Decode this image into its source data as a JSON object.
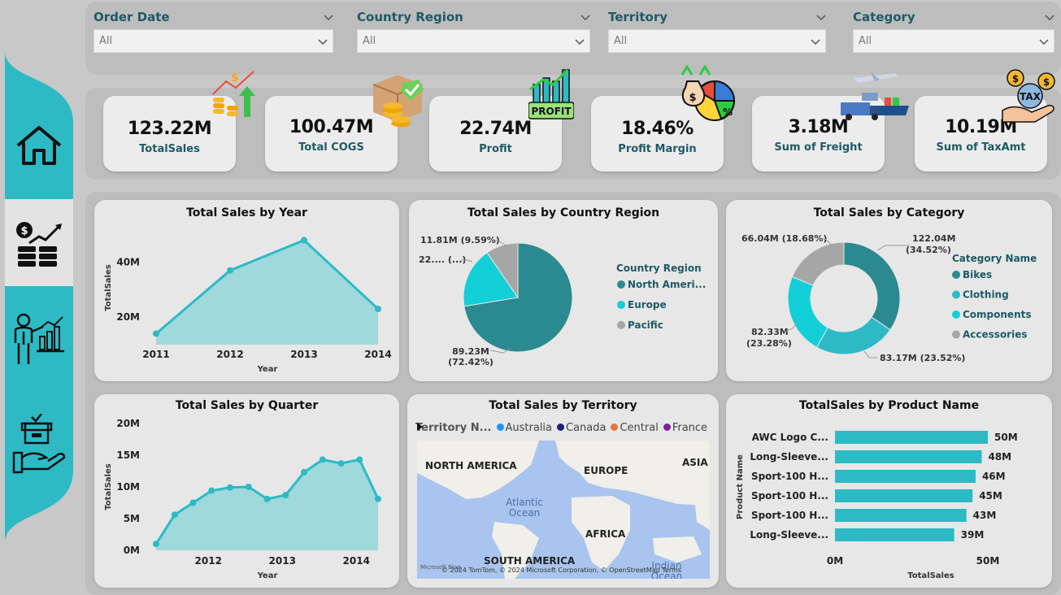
{
  "slicers": [
    {
      "title": "Order Date",
      "value": "All"
    },
    {
      "title": "Country Region",
      "value": "All"
    },
    {
      "title": "Territory",
      "value": "All"
    },
    {
      "title": "Category",
      "value": "All"
    }
  ],
  "kpis": [
    {
      "value": "123.22M",
      "label": "TotalSales",
      "icon": "coins-growth-icon"
    },
    {
      "value": "100.47M",
      "label": "Total COGS",
      "icon": "box-coins-icon"
    },
    {
      "value": "22.74M",
      "label": "Profit",
      "icon": "profit-chart-icon",
      "icon_text": "PROFIT"
    },
    {
      "value": "18.46%",
      "label": "Profit Margin",
      "icon": "money-pie-icon",
      "icon_text": "%"
    },
    {
      "value": "3.18M",
      "label": "Sum of Freight",
      "icon": "freight-icon"
    },
    {
      "value": "10.19M",
      "label": "Sum of TaxAmt",
      "icon": "tax-hand-icon",
      "icon_text": "TAX"
    }
  ],
  "colors": {
    "teal": "#2dbac5",
    "dark_teal": "#2b8a8f",
    "cyan": "#12cfd8",
    "gray": "#a6a6a6",
    "area": "#9fd9db"
  },
  "cards": {
    "sales_by_year": {
      "title": "Total Sales by Year",
      "xlabel": "Year",
      "ylabel": "TotalSales"
    },
    "sales_by_country": {
      "title": "Total Sales by Country Region",
      "legend_title": "Country Region"
    },
    "sales_by_category": {
      "title": "Total Sales by Category",
      "legend_title": "Category Name"
    },
    "sales_by_quarter": {
      "title": "Total Sales by Quarter",
      "xlabel": "Year",
      "ylabel": "TotalSales"
    },
    "sales_by_territory": {
      "title": "Total Sales by Territory",
      "legend_title": "Territory N...",
      "legend": [
        {
          "name": "Australia",
          "color": "#1e90ff"
        },
        {
          "name": "Canada",
          "color": "#1a237e"
        },
        {
          "name": "Central",
          "color": "#e8743b"
        },
        {
          "name": "France",
          "color": "#7b1fa2"
        }
      ],
      "labels": {
        "na": "NORTH AMERICA",
        "eu": "EUROPE",
        "as": "ASIA",
        "af": "AFRICA",
        "sa": "SOUTH AMERICA",
        "atlantic": "Atlantic Ocean",
        "indian": "Indian Ocean"
      },
      "attribution": "© 2024 TomTom, © 2024 Microsoft Corporation, © OpenStreetMap  Terms",
      "ms_logo": "Microsoft Bing"
    },
    "sales_by_product": {
      "title": "TotalSales by Product Name",
      "xlabel": "TotalSales",
      "ylabel": "Product Name"
    }
  },
  "chart_data": [
    {
      "type": "area",
      "title": "Total Sales by Year",
      "x": [
        "2011",
        "2012",
        "2013",
        "2014"
      ],
      "values": [
        14,
        37,
        48,
        23
      ],
      "unit": "M",
      "ytick_labels": [
        "20M",
        "40M"
      ],
      "yticks": [
        20,
        40
      ],
      "ylim": [
        10,
        52
      ],
      "xlabel": "Year",
      "ylabel": "TotalSales"
    },
    {
      "type": "pie",
      "title": "Total Sales by Country Region",
      "categories": [
        "North Ameri...",
        "Europe",
        "Pacific"
      ],
      "values": [
        89.23,
        22.18,
        11.81
      ],
      "data_labels": [
        "89.23M (72.42%)",
        "22.... (...)",
        "11.81M (9.59%)"
      ],
      "legend_title": "Country Region"
    },
    {
      "type": "pie",
      "variant": "donut",
      "title": "Total Sales by Category",
      "categories": [
        "Bikes",
        "Clothing",
        "Components",
        "Accessories"
      ],
      "values": [
        122.04,
        83.17,
        82.33,
        66.04
      ],
      "data_labels": [
        "122.04M (34.52%)",
        "83.17M (23.52%)",
        "82.33M (23.28%)",
        "66.04M (18.68%)"
      ],
      "legend_title": "Category Name"
    },
    {
      "type": "area",
      "title": "Total Sales by Quarter",
      "xtick_labels": [
        "2012",
        "2013",
        "2014"
      ],
      "values": [
        1.0,
        5.6,
        7.5,
        9.4,
        9.9,
        10.0,
        8.1,
        8.7,
        12.3,
        14.3,
        13.7,
        14.3,
        8.1
      ],
      "unit": "M",
      "ytick_labels": [
        "0M",
        "5M",
        "10M",
        "15M",
        "20M"
      ],
      "yticks": [
        0,
        5,
        10,
        15,
        20
      ],
      "ylim": [
        0,
        20
      ],
      "xlabel": "Year",
      "ylabel": "TotalSales"
    },
    {
      "type": "bar",
      "orientation": "horizontal",
      "title": "TotalSales by Product Name",
      "categories": [
        "AWC Logo C...",
        "Long-Sleeve...",
        "Sport-100 H...",
        "Sport-100 H...",
        "Sport-100 H...",
        "Long-Sleeve..."
      ],
      "values": [
        50,
        48,
        46,
        45,
        43,
        39
      ],
      "data_labels": [
        "50M",
        "48M",
        "46M",
        "45M",
        "43M",
        "39M"
      ],
      "xtick_labels": [
        "0M",
        "50M"
      ],
      "xticks": [
        0,
        50
      ],
      "xlabel": "TotalSales",
      "ylabel": "Product Name"
    }
  ]
}
